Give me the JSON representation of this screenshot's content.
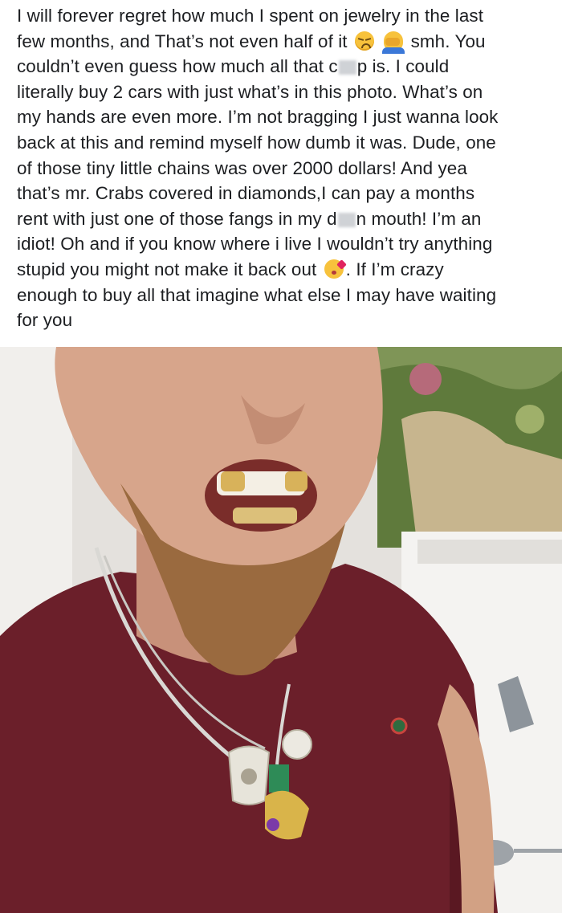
{
  "post": {
    "caption_lines": [
      {
        "text": "I will forever regret how much I spent on jewelry in the last"
      },
      {
        "pre": "few months, and That’s not even half of it",
        "emoji1": "disappointed-face",
        "emoji2": "person-facepalming",
        "post": "smh. You"
      },
      {
        "pre": "couldn’t even guess how much all that c",
        "post": "p is. I could"
      },
      {
        "text": "literally buy 2 cars with just what’s in this photo. What’s on"
      },
      {
        "text": "my hands are even more. I’m not bragging I just wanna look"
      },
      {
        "text": "back at this and remind myself how dumb it was. Dude, one"
      },
      {
        "text": "of those tiny little chains was over 2000 dollars! And yea"
      },
      {
        "text": "that’s mr. Crabs covered in diamonds,I can pay a months"
      },
      {
        "pre": "rent with just one of those fangs in my d",
        "post": "n mouth! I’m an"
      },
      {
        "text": "idiot! Oh and if you know where i live I wouldn’t try anything"
      },
      {
        "pre": "stupid you might not make it back out",
        "emoji": "face-blowing-kiss",
        "post": ". If I’m crazy"
      },
      {
        "text": "enough to buy all that imagine what else I may have waiting"
      },
      {
        "text": "for you"
      }
    ]
  },
  "photo": {
    "subject": "selfie",
    "colors": {
      "shirt": "#6b1f2a",
      "skin": "#d7a58b",
      "beard": "#9a6a3f",
      "wall": "#e9e6e2",
      "mural": "#6f8a4a"
    }
  }
}
